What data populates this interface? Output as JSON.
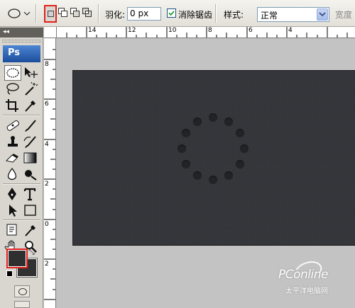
{
  "options_bar": {
    "feather_label": "羽化:",
    "feather_value": "0 px",
    "antialias_label": "消除锯齿",
    "antialias_checked": true,
    "style_label": "样式:",
    "style_value": "正常",
    "width_label": "宽度"
  },
  "toolbox": {
    "logo_text": "Ps",
    "tools": [
      "elliptical-marquee-icon",
      "move-icon",
      "lasso-icon",
      "magic-wand-icon",
      "crop-icon",
      "eyedropper-icon",
      "healing-brush-icon",
      "brush-icon",
      "clone-stamp-icon",
      "history-brush-icon",
      "eraser-icon",
      "gradient-icon",
      "blur-icon",
      "dodge-icon",
      "pen-icon",
      "type-icon",
      "path-selection-icon",
      "rectangle-shape-icon",
      "notes-icon",
      "eyedropper-2-icon",
      "hand-icon",
      "zoom-icon"
    ],
    "foreground_color": "#2f2f2f",
    "background_color": "#323232"
  },
  "ruler": {
    "top_labels": [
      "14",
      "12",
      "10",
      "8",
      "6",
      "4"
    ],
    "left_labels": [
      "8",
      "6",
      "4",
      "2",
      "0",
      "2"
    ]
  },
  "canvas": {
    "background_color": "#34353a",
    "dot_color": "#222326",
    "dot_count": 12
  },
  "watermark": {
    "brand": "PConline",
    "subtitle": "太平洋电脑网"
  }
}
